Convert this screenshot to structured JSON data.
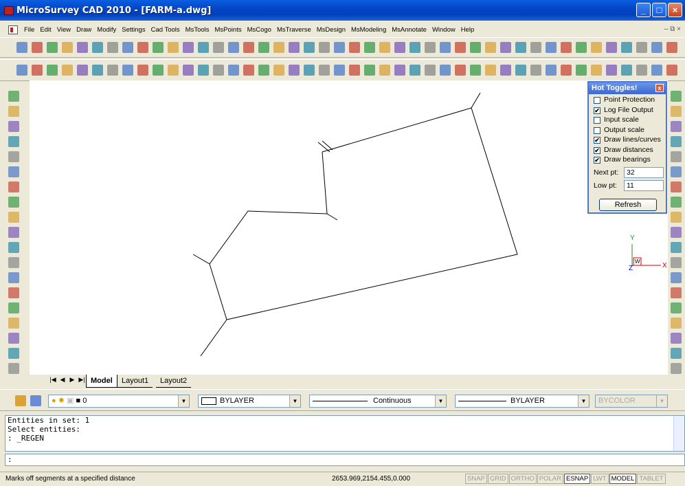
{
  "window": {
    "title": "MicroSurvey CAD 2010 - [FARM-a.dwg]",
    "colors": {
      "title_bar": "#0346c8",
      "close_button": "#c8421e",
      "accent_red": "#b22222"
    }
  },
  "menu": {
    "items": [
      "File",
      "Edit",
      "View",
      "Draw",
      "Modify",
      "Settings",
      "Cad Tools",
      "MsTools",
      "MsPoints",
      "MsCogo",
      "MsTraverse",
      "MsDesign",
      "MsModeling",
      "MsAnnotate",
      "Window",
      "Help"
    ],
    "mdi_controls": "– ⧉ ×"
  },
  "hot_toggles": {
    "title": "Hot Toggles!",
    "close_label": "x",
    "items": [
      {
        "label": "Point Protection",
        "checked": false
      },
      {
        "label": "Log File Output",
        "checked": true
      },
      {
        "label": "Input scale",
        "checked": false
      },
      {
        "label": "Output scale",
        "checked": false
      },
      {
        "label": "Draw lines/curves",
        "checked": true
      },
      {
        "label": "Draw distances",
        "checked": true
      },
      {
        "label": "Draw bearings",
        "checked": true
      }
    ],
    "next_pt_label": "Next pt:",
    "next_pt_value": "32",
    "low_pt_label": "Low pt:",
    "low_pt_value": "11",
    "refresh_label": "Refresh"
  },
  "ucs": {
    "y_label": "Y",
    "x_label": "X",
    "z_label": "Z",
    "w_label": "W"
  },
  "tabs": {
    "nav": [
      "|◀",
      "◀",
      "▶",
      "▶|"
    ],
    "items": [
      {
        "label": "Model",
        "active": true
      },
      {
        "label": "Layout1",
        "active": false
      },
      {
        "label": "Layout2",
        "active": false
      }
    ]
  },
  "properties": {
    "layer": "0",
    "color": "BYLAYER",
    "linetype": "Continuous",
    "lineweight": "BYLAYER",
    "plotstyle": "BYCOLOR"
  },
  "command": {
    "lines": [
      "Entities in set: 1",
      "Select entities:",
      ": _REGEN"
    ],
    "prompt": ":"
  },
  "status": {
    "help_text": "Marks off segments at a specified distance",
    "coordinates": "2653.969,2154.455,0.000",
    "buttons": [
      {
        "label": "SNAP",
        "on": false
      },
      {
        "label": "GRID",
        "on": false
      },
      {
        "label": "ORTHO",
        "on": false
      },
      {
        "label": "POLAR",
        "on": false
      },
      {
        "label": "ESNAP",
        "on": true
      },
      {
        "label": "LWT",
        "on": false
      },
      {
        "label": "MODEL",
        "on": true
      },
      {
        "label": "TABLET",
        "on": false
      }
    ]
  }
}
